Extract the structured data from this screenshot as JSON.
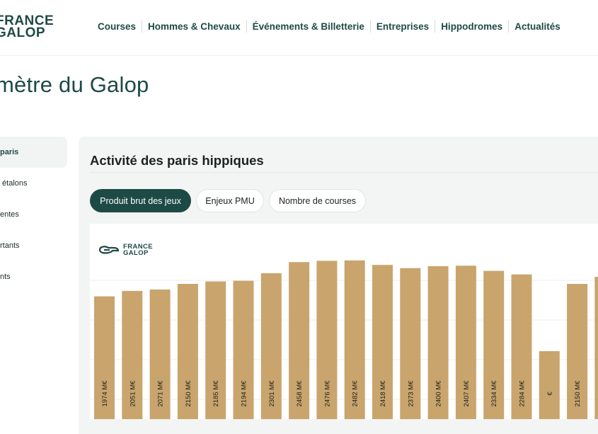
{
  "header": {
    "logo_line1": "FRANCE",
    "logo_line2": "GALOP",
    "nav": [
      "Courses",
      "Hommes & Chevaux",
      "Événements & Billetterie",
      "Entreprises",
      "Hippodromes",
      "Actualités"
    ]
  },
  "page_title": "mètre du Galop",
  "sidebar": {
    "items": [
      {
        "label": "paris",
        "active": true
      },
      {
        "label": " étalons",
        "active": false
      },
      {
        "label": "entes",
        "active": false
      },
      {
        "label": "rtants",
        "active": false
      },
      {
        "label": "nts",
        "active": false
      }
    ]
  },
  "panel": {
    "title": "Activité des paris hippiques",
    "tabs": [
      {
        "label": "Produit brut des jeux",
        "active": true
      },
      {
        "label": "Enjeux PMU",
        "active": false
      },
      {
        "label": "Nombre de courses",
        "active": false
      }
    ]
  },
  "chart_logo": {
    "line1": "FRANCE",
    "line2": "GALOP"
  },
  "colors": {
    "brand": "#1e4a45",
    "bar": "#c9a46c",
    "panel": "#f3f5f4"
  },
  "chart_data": {
    "type": "bar",
    "values": [
      1974,
      2051,
      2071,
      2150,
      2185,
      2194,
      2301,
      2458,
      2476,
      2482,
      2418,
      2373,
      2400,
      2407,
      2334,
      2284,
      1200,
      2150,
      2250
    ],
    "data_labels": [
      "1974 M€",
      "2051 M€",
      "2071 M€",
      "2150 M€",
      "2185 M€",
      "2194 M€",
      "2301 M€",
      "2458 M€",
      "2476 M€",
      "2482 M€",
      "2418 M€",
      "2373 M€",
      "2400 M€",
      "2407 M€",
      "2334 M€",
      "2284 M€",
      "€",
      "2150 M€",
      ""
    ],
    "ylim": [
      0,
      2500
    ],
    "grid": true
  }
}
